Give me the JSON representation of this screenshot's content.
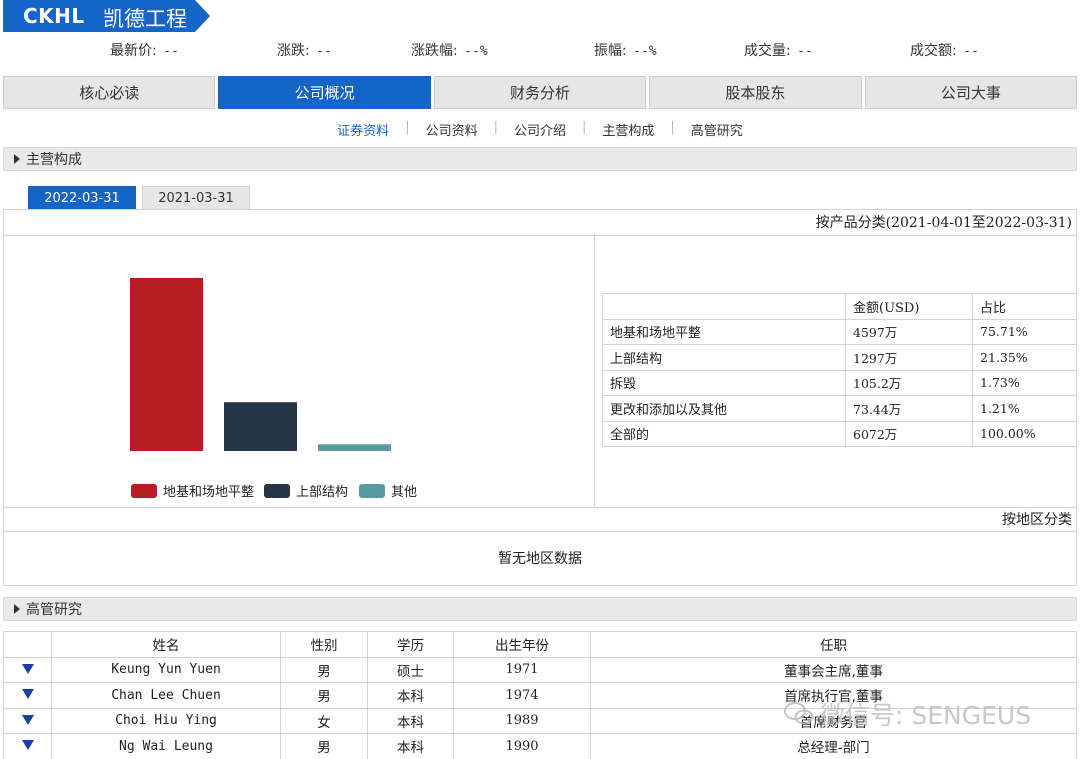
{
  "header": {
    "code": "CKHL",
    "name": "凯德工程"
  },
  "quote": [
    {
      "label": "最新价:",
      "value": "--"
    },
    {
      "label": "涨跌:",
      "value": "--"
    },
    {
      "label": "涨跌幅:",
      "value": "--%"
    },
    {
      "label": "振幅:",
      "value": "--%"
    },
    {
      "label": "成交量:",
      "value": "--"
    },
    {
      "label": "成交额:",
      "value": "--"
    }
  ],
  "tabs": [
    "核心必读",
    "公司概况",
    "财务分析",
    "股本股东",
    "公司大事"
  ],
  "subnav": [
    "证券资料",
    "公司资料",
    "公司介绍",
    "主营构成",
    "高管研究"
  ],
  "main_business": {
    "section_title": "主营构成",
    "periods": [
      "2022-03-31",
      "2021-03-31"
    ],
    "product_title": "按产品分类(2021-04-01至2022-03-31)",
    "table_headers": [
      "",
      "金额(USD)",
      "占比"
    ],
    "rows": [
      {
        "name": "地基和场地平整",
        "amount": "4597万",
        "pct": "75.71%"
      },
      {
        "name": "上部结构",
        "amount": "1297万",
        "pct": "21.35%"
      },
      {
        "name": "拆毁",
        "amount": "105.2万",
        "pct": "1.73%"
      },
      {
        "name": "更改和添加以及其他",
        "amount": "73.44万",
        "pct": "1.21%"
      },
      {
        "name": "全部的",
        "amount": "6072万",
        "pct": "100.00%"
      }
    ],
    "region_title": "按地区分类",
    "region_empty": "暂无地区数据"
  },
  "chart_data": {
    "type": "bar",
    "categories": [
      "地基和场地平整",
      "上部结构",
      "其他"
    ],
    "values": [
      75.71,
      21.35,
      2.94
    ],
    "colors": [
      "#b71c24",
      "#263545",
      "#5b9aa0"
    ],
    "legend": [
      "地基和场地平整",
      "上部结构",
      "其他"
    ],
    "legend_position": "bottom",
    "grid": false
  },
  "executives": {
    "section_title": "高管研究",
    "headers": [
      "",
      "姓名",
      "性别",
      "学历",
      "出生年份",
      "任职"
    ],
    "rows": [
      {
        "name": "Keung Yun Yuen",
        "gender": "男",
        "edu": "硕士",
        "year": "1971",
        "role": "董事会主席,董事"
      },
      {
        "name": "Chan Lee Chuen",
        "gender": "男",
        "edu": "本科",
        "year": "1974",
        "role": "首席执行官,董事"
      },
      {
        "name": "Choi Hiu Ying",
        "gender": "女",
        "edu": "本科",
        "year": "1989",
        "role": "首席财务官"
      },
      {
        "name": "Ng Wai Leung",
        "gender": "男",
        "edu": "本科",
        "year": "1990",
        "role": "总经理-部门"
      }
    ]
  },
  "watermark": "微信号: SENGEUS"
}
